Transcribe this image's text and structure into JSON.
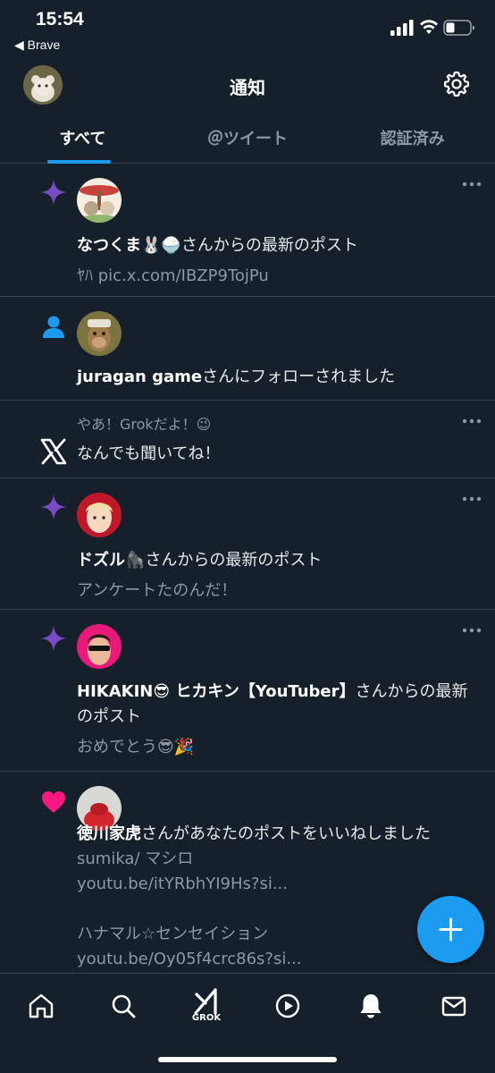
{
  "status_bar": {
    "time": "15:54",
    "back_app": "◀ Brave"
  },
  "header": {
    "title": "通知",
    "settings_icon": "gear-icon"
  },
  "tabs": [
    {
      "label": "すべて",
      "active": true
    },
    {
      "label": "＠ツイート",
      "active": false
    },
    {
      "label": "認証済み",
      "active": false
    }
  ],
  "notifications": [
    {
      "type": "new-post",
      "icon": "sparkle-icon",
      "name": "なつくま🐰🍚",
      "text": "さんからの最新のポスト",
      "sub": "ﾔﾊ pic.x.com/IBZP9TojPu"
    },
    {
      "type": "follow",
      "icon": "person-icon",
      "name": "juragan game",
      "text": "さんにフォローされました"
    },
    {
      "type": "grok",
      "icon": "x-logo-icon",
      "header": "やあ！Grokだよ！😉",
      "text": "なんでも聞いてね！"
    },
    {
      "type": "new-post",
      "icon": "sparkle-icon",
      "name": "ドズル🦍",
      "text": "さんからの最新のポスト",
      "sub": "アンケートたのんだ！"
    },
    {
      "type": "new-post",
      "icon": "sparkle-icon",
      "name": "HIKAKIN😎 ヒカキン【YouTuber】",
      "text": "さんからの最新のポスト",
      "sub": "おめでとう😎🎉"
    },
    {
      "type": "like",
      "icon": "heart-icon",
      "name": "徳川家虎",
      "text": "さんがあなたのポストをいいねしました",
      "sub_lines": [
        "sumika/ マシロ",
        "youtu.be/itYRbhYI9Hs?si...",
        "",
        "ハナマル☆センセイション",
        "youtu.be/Oy05f4crc86s?si..."
      ]
    }
  ],
  "bottom_nav": {
    "items": [
      "home-icon",
      "search-icon",
      "grok-icon",
      "play-icon",
      "bell-icon",
      "mail-icon"
    ],
    "grok_label": "GROK"
  },
  "fab_icon": "plus-icon",
  "colors": {
    "background": "#15202b",
    "accent": "#1d9bf0",
    "sparkle": "#794bc4",
    "heart": "#f91880",
    "muted": "#8b98a5",
    "divider": "#38444d"
  }
}
